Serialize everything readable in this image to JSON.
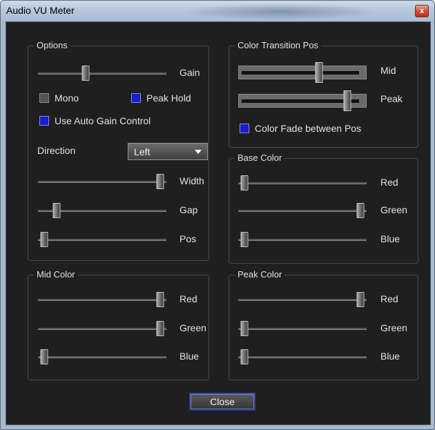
{
  "window": {
    "title": "Audio VU Meter",
    "close_glyph": "x"
  },
  "options": {
    "title": "Options",
    "gain_label": "Gain",
    "gain_value": 0.36,
    "mono_label": "Mono",
    "mono_checked": false,
    "peak_hold_label": "Peak Hold",
    "peak_hold_checked": true,
    "auto_gain_label": "Use Auto Gain Control",
    "auto_gain_checked": true,
    "direction_label": "Direction",
    "direction_value": "Left",
    "width_label": "Width",
    "width_value": 0.98,
    "gap_label": "Gap",
    "gap_value": 0.12,
    "pos_label": "Pos",
    "pos_value": 0.02
  },
  "color_transition": {
    "title": "Color Transition Pos",
    "mid_label": "Mid",
    "mid_value": 0.64,
    "peak_label": "Peak",
    "peak_value": 0.88,
    "fade_label": "Color Fade between Pos",
    "fade_checked": true
  },
  "base_color": {
    "title": "Base Color",
    "red_label": "Red",
    "red_value": 0.02,
    "green_label": "Green",
    "green_value": 0.98,
    "blue_label": "Blue",
    "blue_value": 0.02
  },
  "mid_color": {
    "title": "Mid Color",
    "red_label": "Red",
    "red_value": 0.98,
    "green_label": "Green",
    "green_value": 0.98,
    "blue_label": "Blue",
    "blue_value": 0.02
  },
  "peak_color": {
    "title": "Peak Color",
    "red_label": "Red",
    "red_value": 0.98,
    "green_label": "Green",
    "green_value": 0.02,
    "blue_label": "Blue",
    "blue_value": 0.02
  },
  "close_label": "Close",
  "colors": {
    "checkbox_on": "#1c1ccc",
    "accent_border": "#2a36c8",
    "background": "#1f1f1f"
  }
}
